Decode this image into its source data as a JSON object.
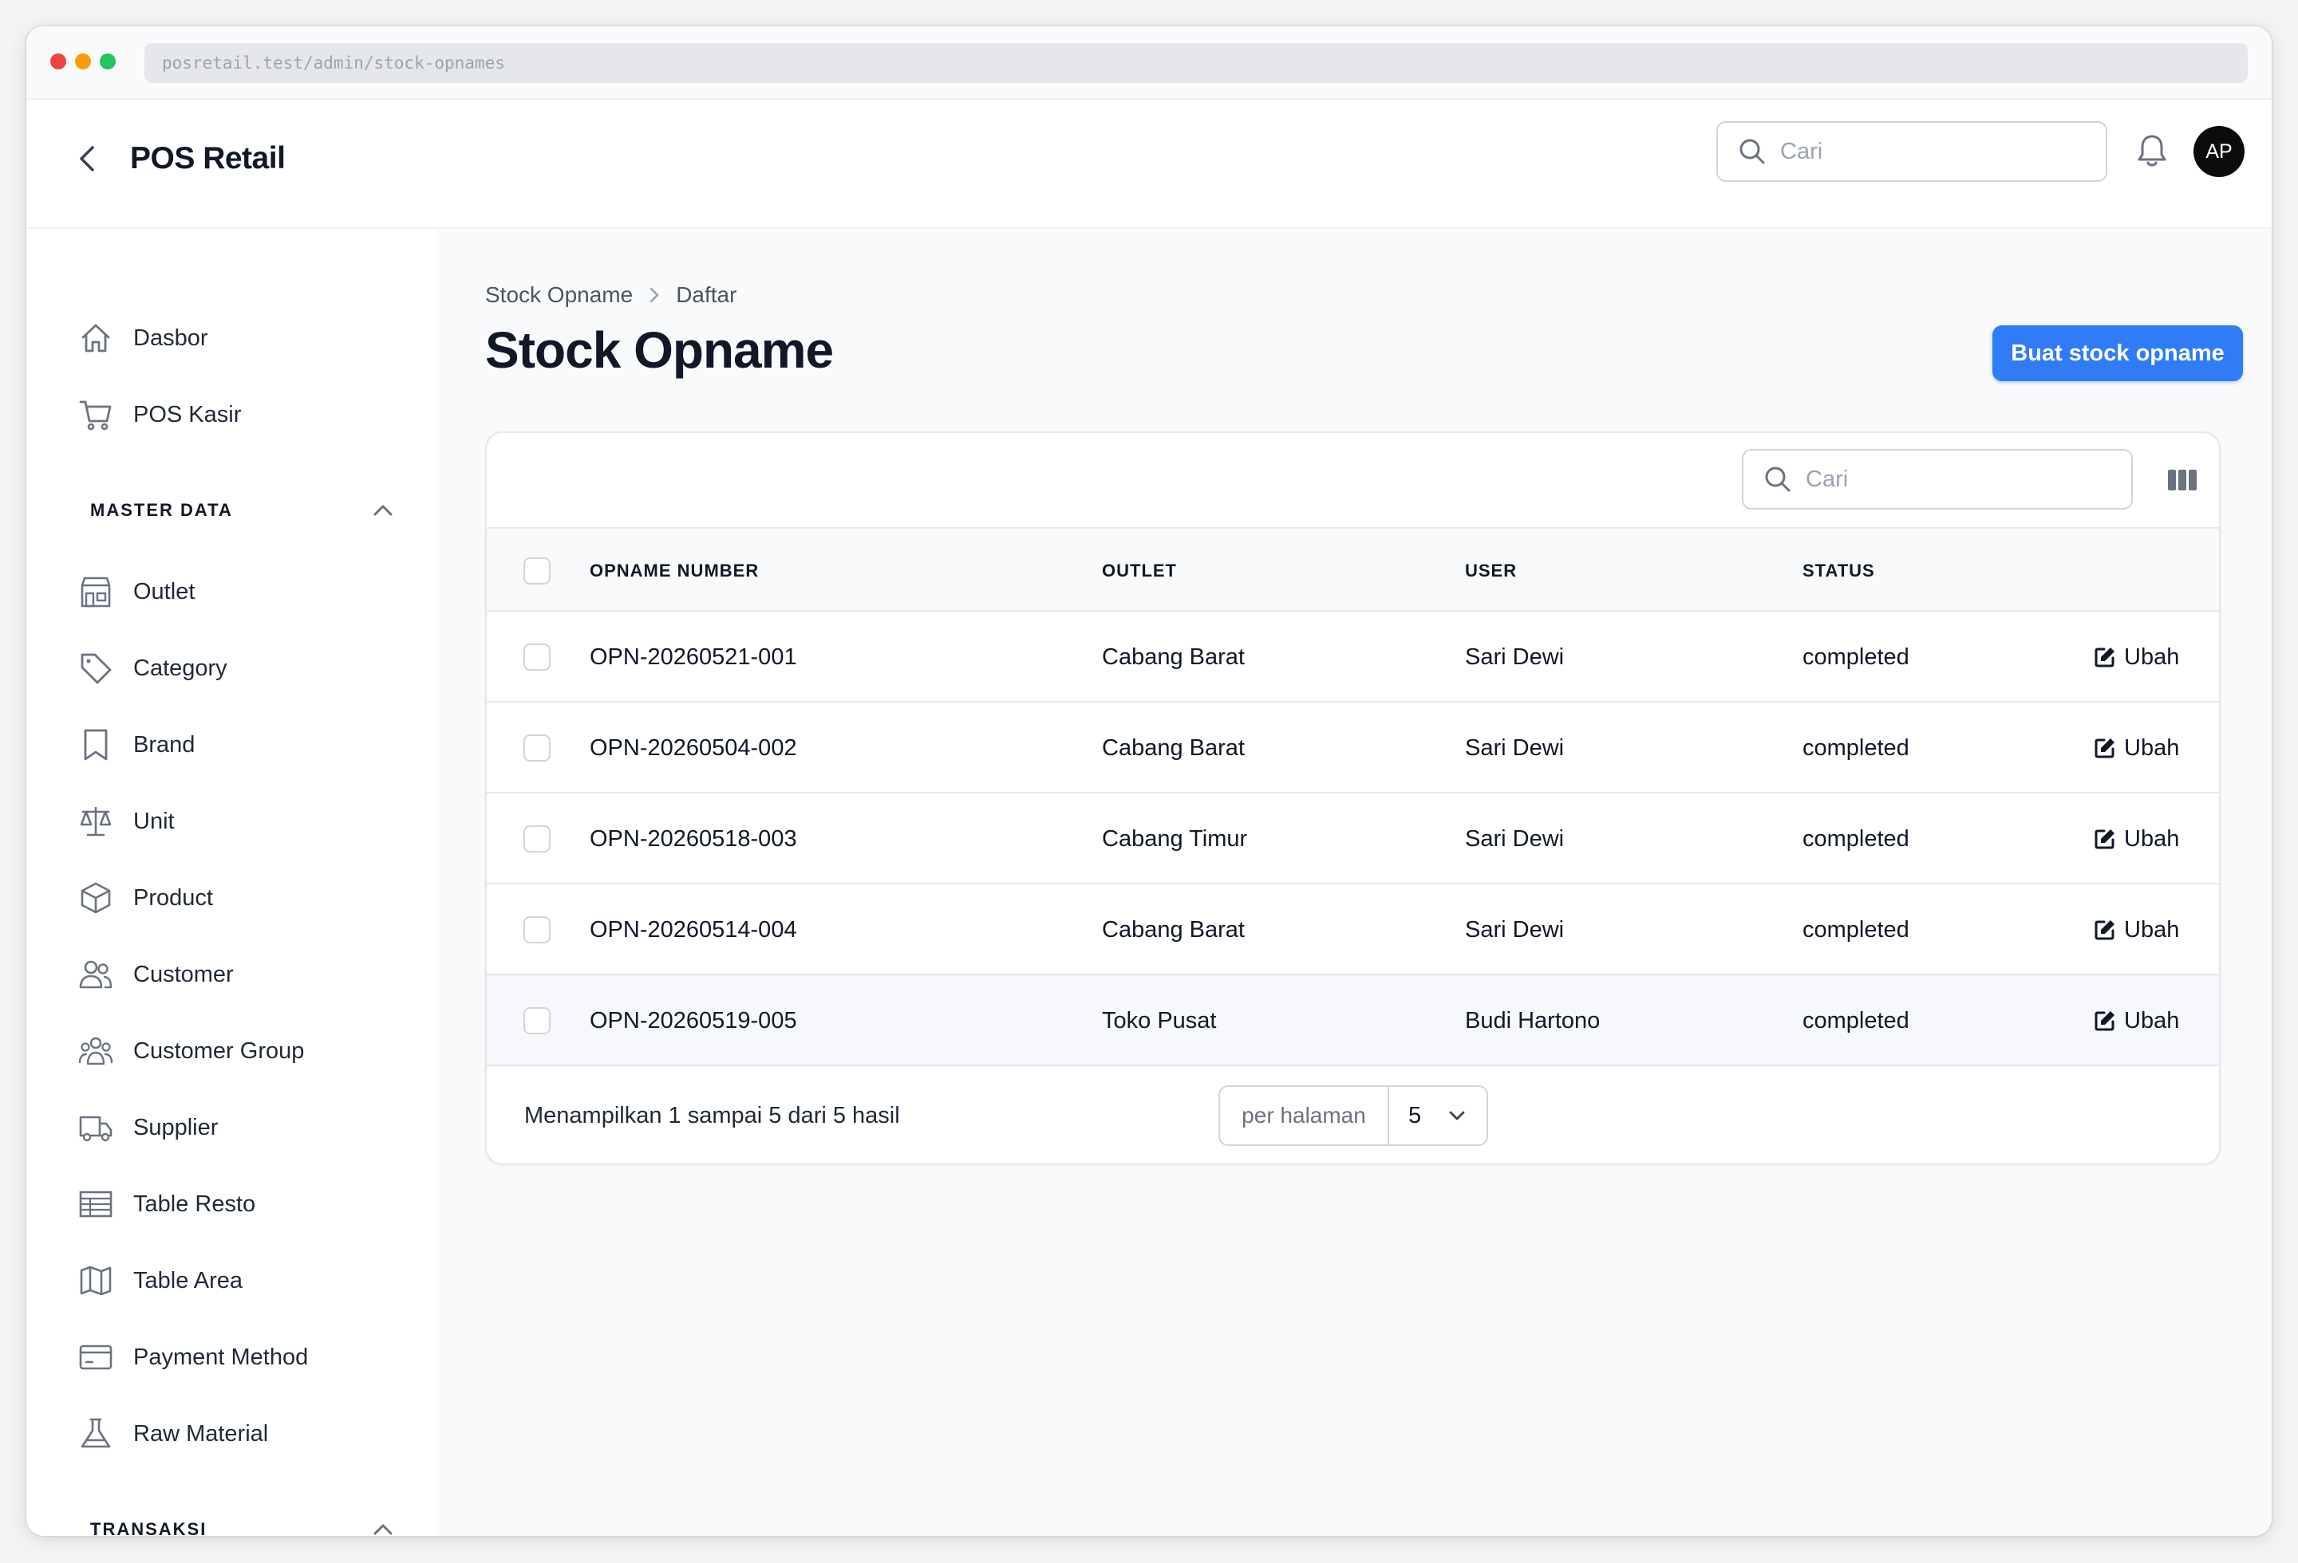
{
  "browser": {
    "url": "posretail.test/admin/stock-opnames"
  },
  "header": {
    "app_title": "POS Retail",
    "search_placeholder": "Cari",
    "avatar_initials": "AP"
  },
  "sidebar": {
    "top_items": [
      {
        "label": "Dasbor",
        "icon": "home-icon"
      },
      {
        "label": "POS Kasir",
        "icon": "cart-icon"
      }
    ],
    "groups": [
      {
        "label": "MASTER DATA",
        "expanded": true,
        "items": [
          {
            "label": "Outlet",
            "icon": "store-icon"
          },
          {
            "label": "Category",
            "icon": "tag-icon"
          },
          {
            "label": "Brand",
            "icon": "bookmark-icon"
          },
          {
            "label": "Unit",
            "icon": "scale-icon"
          },
          {
            "label": "Product",
            "icon": "cube-icon"
          },
          {
            "label": "Customer",
            "icon": "users-icon"
          },
          {
            "label": "Customer Group",
            "icon": "user-group-icon"
          },
          {
            "label": "Supplier",
            "icon": "truck-icon"
          },
          {
            "label": "Table Resto",
            "icon": "table-icon"
          },
          {
            "label": "Table Area",
            "icon": "map-icon"
          },
          {
            "label": "Payment Method",
            "icon": "credit-card-icon"
          },
          {
            "label": "Raw Material",
            "icon": "beaker-icon"
          }
        ]
      },
      {
        "label": "TRANSAKSI",
        "expanded": true
      }
    ]
  },
  "breadcrumb": [
    "Stock Opname",
    "Daftar"
  ],
  "page": {
    "title": "Stock Opname",
    "create_button": "Buat stock opname"
  },
  "table": {
    "search_placeholder": "Cari",
    "columns": [
      "OPNAME NUMBER",
      "OUTLET",
      "USER",
      "STATUS"
    ],
    "rows": [
      {
        "number": "OPN-20260521-001",
        "outlet": "Cabang Barat",
        "user": "Sari Dewi",
        "status": "completed",
        "action": "Ubah"
      },
      {
        "number": "OPN-20260504-002",
        "outlet": "Cabang Barat",
        "user": "Sari Dewi",
        "status": "completed",
        "action": "Ubah"
      },
      {
        "number": "OPN-20260518-003",
        "outlet": "Cabang Timur",
        "user": "Sari Dewi",
        "status": "completed",
        "action": "Ubah"
      },
      {
        "number": "OPN-20260514-004",
        "outlet": "Cabang Barat",
        "user": "Sari Dewi",
        "status": "completed",
        "action": "Ubah"
      },
      {
        "number": "OPN-20260519-005",
        "outlet": "Toko Pusat",
        "user": "Budi Hartono",
        "status": "completed",
        "action": "Ubah"
      }
    ],
    "summary": "Menampilkan 1 sampai 5 dari 5 hasil",
    "per_page_label": "per halaman",
    "per_page_value": "5"
  },
  "colors": {
    "primary": "#2f7cf6",
    "avatar_bg": "#0b0b0b",
    "main_bg": "#f9fafb",
    "icon_gray": "#6b7280"
  }
}
